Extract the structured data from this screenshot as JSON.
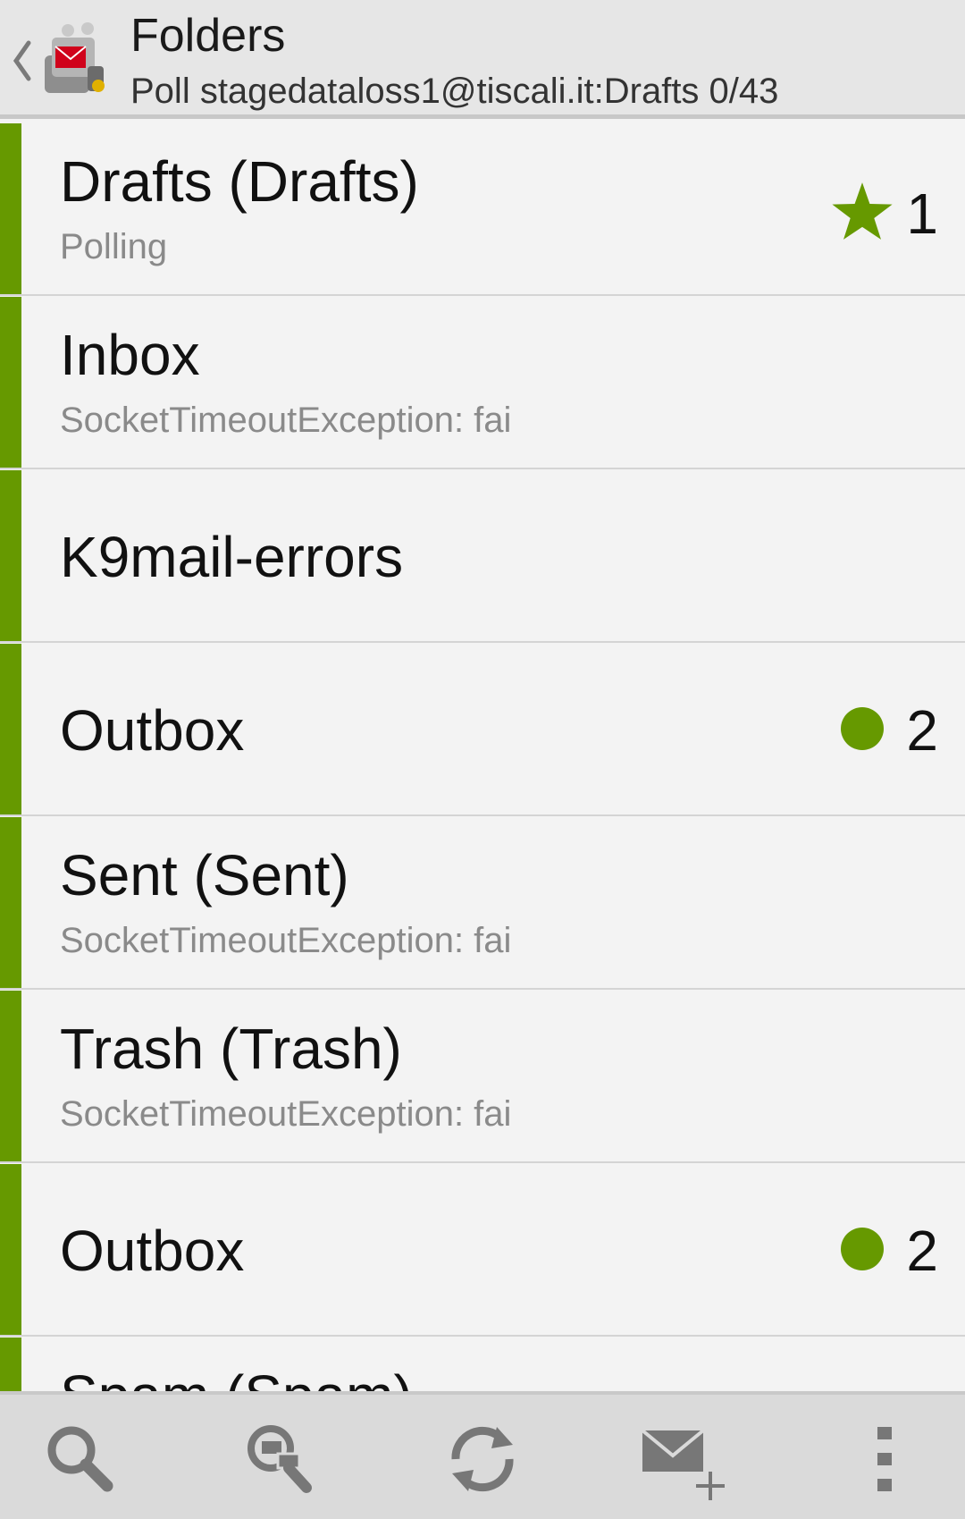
{
  "header": {
    "title": "Folders",
    "subtitle": "Poll stagedataloss1@tiscali.it:Drafts 0/43",
    "back_icon": "chevron-left-icon",
    "app_icon": "k9-mail-app-icon"
  },
  "folders": [
    {
      "name": "Drafts (Drafts)",
      "status": "Polling",
      "badge_icon": "star-icon",
      "count": "1"
    },
    {
      "name": "Inbox",
      "status": "SocketTimeoutException: fai",
      "badge_icon": "",
      "count": ""
    },
    {
      "name": "K9mail-errors",
      "status": "",
      "badge_icon": "",
      "count": ""
    },
    {
      "name": "Outbox",
      "status": "",
      "badge_icon": "unread-dot-icon",
      "count": "2"
    },
    {
      "name": "Sent (Sent)",
      "status": "SocketTimeoutException: fai",
      "badge_icon": "",
      "count": ""
    },
    {
      "name": "Trash (Trash)",
      "status": "SocketTimeoutException: fai",
      "badge_icon": "",
      "count": ""
    },
    {
      "name": "Outbox",
      "status": "",
      "badge_icon": "unread-dot-icon",
      "count": "2"
    },
    {
      "name": "Spam (Spam)",
      "status": "",
      "badge_icon": "",
      "count": ""
    }
  ],
  "toolbar": {
    "items": [
      "search-icon",
      "search-messages-icon",
      "refresh-icon",
      "compose-icon",
      "overflow-menu-icon"
    ]
  },
  "colors": {
    "accent": "#669900",
    "header_bg": "#e6e6e6",
    "toolbar_bg": "#dadada",
    "list_bg": "#f3f3f3"
  }
}
